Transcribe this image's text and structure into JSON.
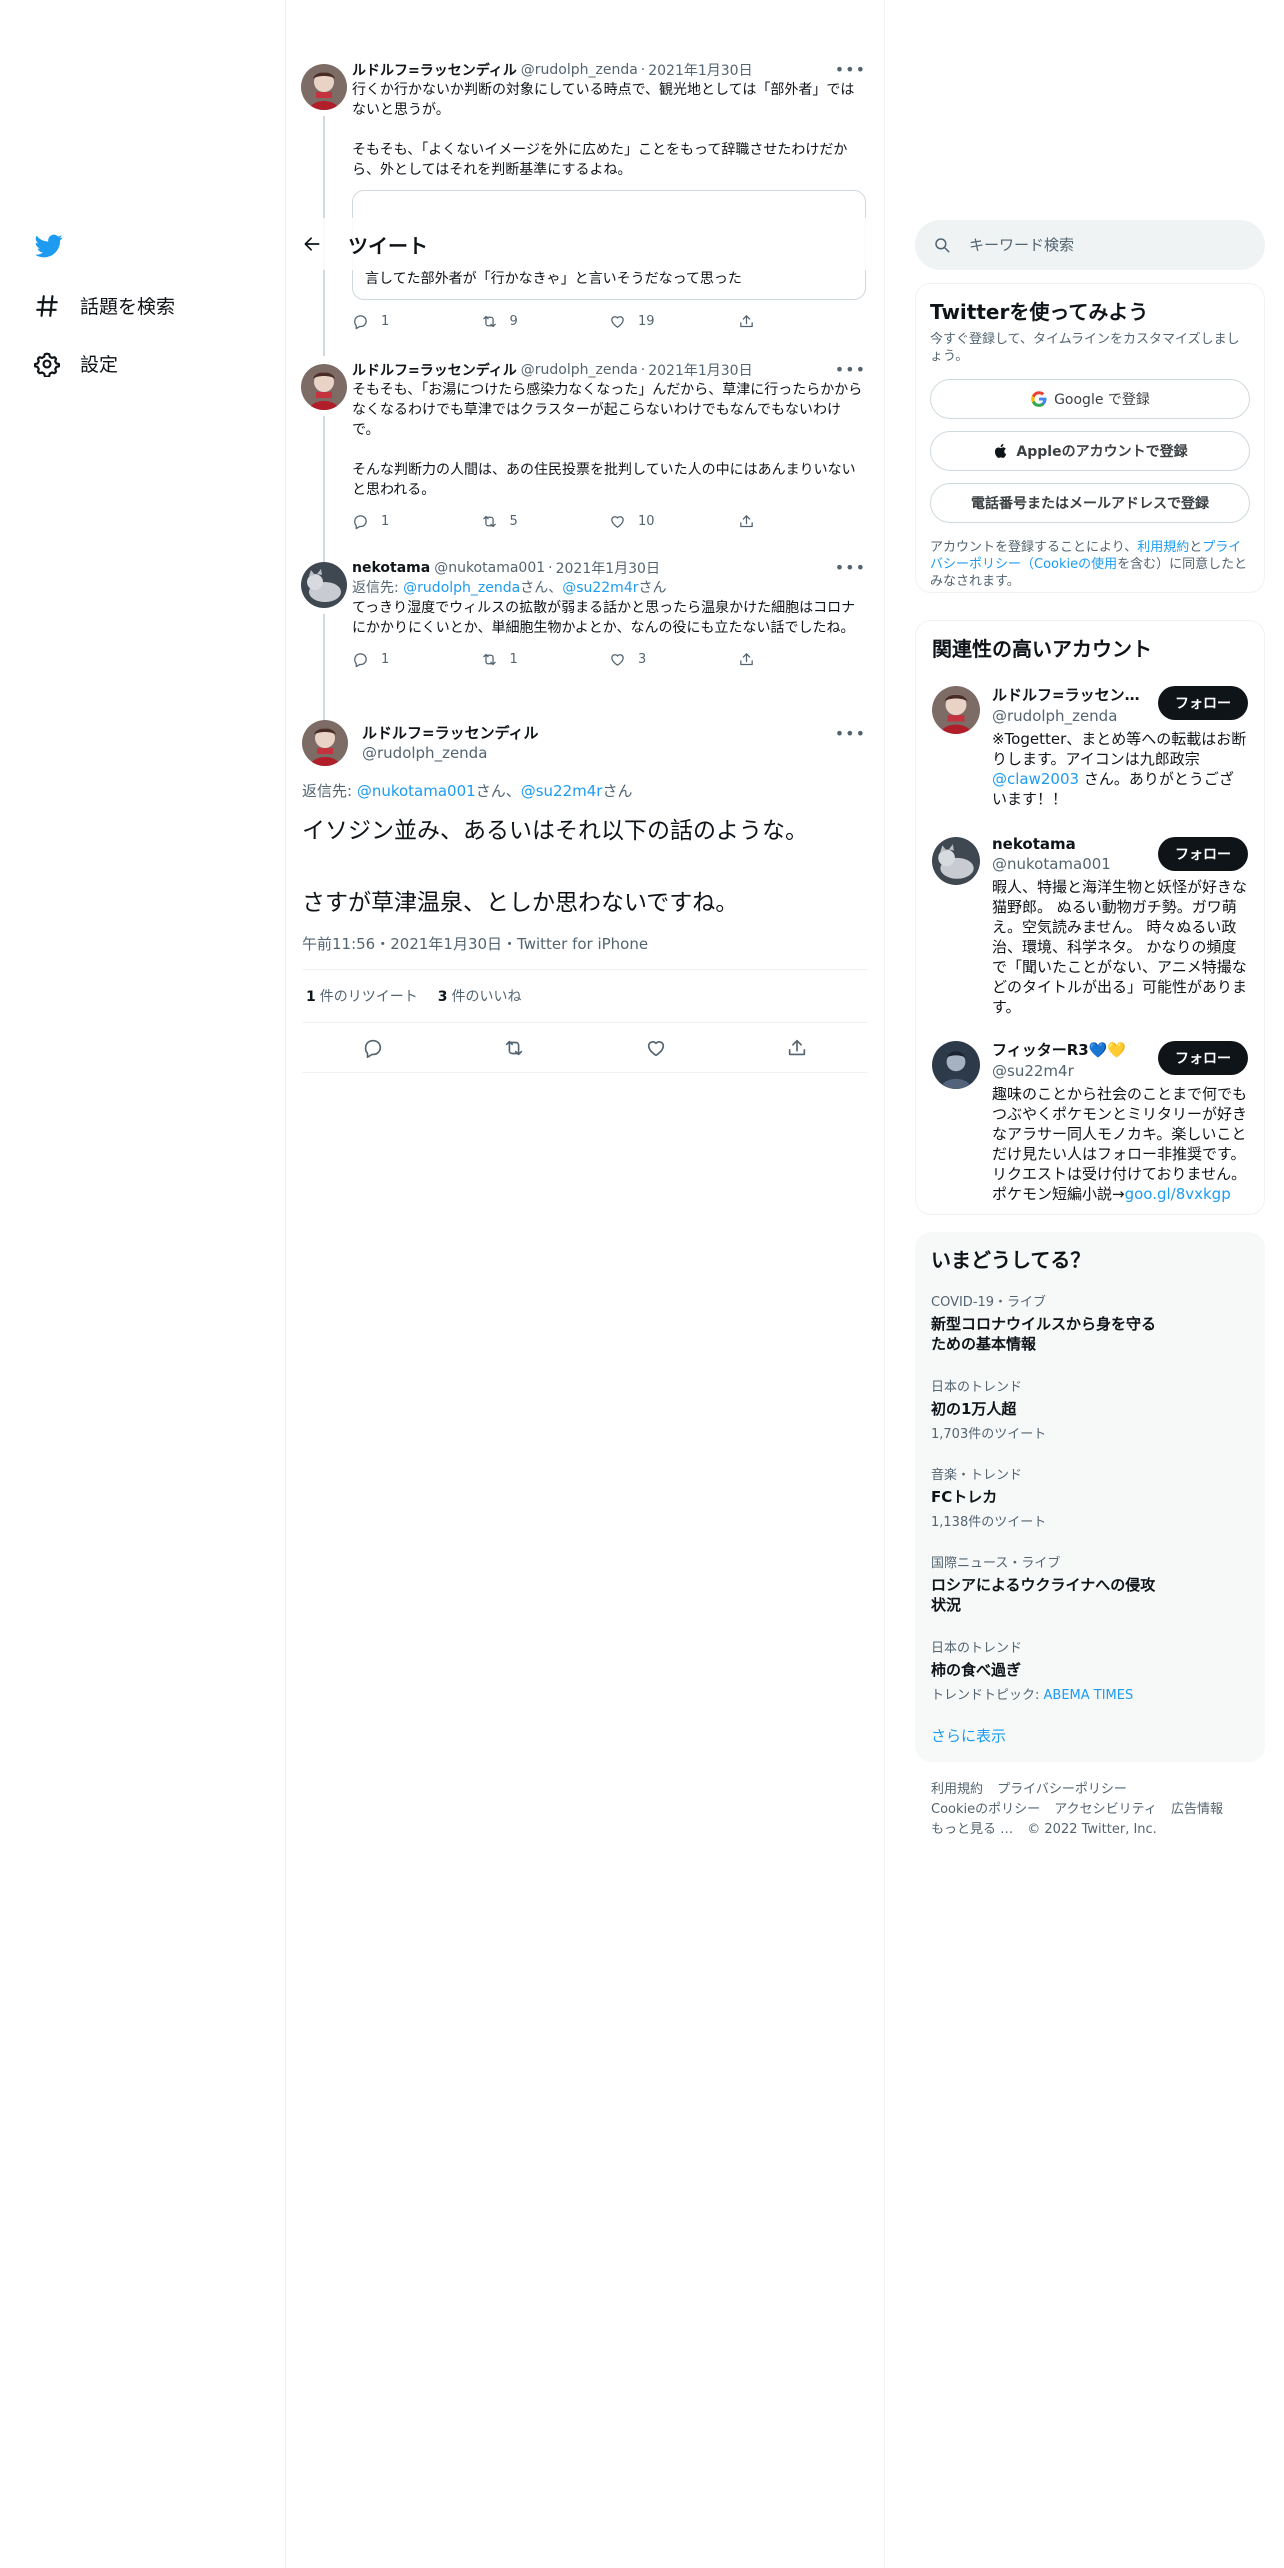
{
  "nav": {
    "explore_label": "話題を検索",
    "settings_label": "設定"
  },
  "header": {
    "title": "ツイート"
  },
  "thread": [
    {
      "name": "ルドルフ=ラッセンディル",
      "handle": "@rudolph_zenda",
      "date": "2021年1月30日",
      "text": "行くか行かないか判断の対象にしている時点で、観光地としては「部外者」ではないと思うが。\n\nそもそも、「よくないイメージを外に広めた」ことをもって辞職させたわけだから、外としてはそれを判断基準にするよね。",
      "quote_text": "言してた部外者が「行かなきゃ」と言いそうだなって思った",
      "replies": "1",
      "retweets": "9",
      "likes": "19"
    },
    {
      "name": "ルドルフ=ラッセンディル",
      "handle": "@rudolph_zenda",
      "date": "2021年1月30日",
      "text": "そもそも、「お湯につけたら感染力なくなった」んだから、草津に行ったらかからなくなるわけでも草津ではクラスターが起こらないわけでもなんでもないわけで。\n\nそんな判断力の人間は、あの住民投票を批判していた人の中にはあんまりいないと思われる。",
      "replies": "1",
      "retweets": "5",
      "likes": "10"
    },
    {
      "name": "nekotama",
      "handle": "@nukotama001",
      "date": "2021年1月30日",
      "reply_prefix": "返信先: ",
      "reply_user1": "@rudolph_zenda",
      "reply_san1": "さん、",
      "reply_user2": "@su22m4r",
      "reply_san2": "さん",
      "text": "てっきり湿度でウィルスの拡散が弱まる話かと思ったら温泉かけた細胞はコロナにかかりにくいとか、単細胞生物かよとか、なんの役にも立たない話でしたね。",
      "replies": "1",
      "retweets": "1",
      "likes": "3"
    }
  ],
  "main_tweet": {
    "name": "ルドルフ=ラッセンディル",
    "handle": "@rudolph_zenda",
    "reply_prefix": "返信先: ",
    "reply_user1": "@nukotama001",
    "reply_san1": "さん、",
    "reply_user2": "@su22m4r",
    "reply_san2": "さん",
    "text": "イソジン並み、あるいはそれ以下の話のような。\n\nさすが草津温泉、としか思わないですね。",
    "meta": "午前11:56・2021年1月30日・Twitter for iPhone",
    "retweets_count": "1",
    "retweets_label": "件のリツイート",
    "likes_count": "3",
    "likes_label": "件のいいね"
  },
  "search": {
    "placeholder": "キーワード検索"
  },
  "signup": {
    "title": "Twitterを使ってみよう",
    "subtitle": "今すぐ登録して、タイムラインをカスタマイズしましょう。",
    "google_label": "Google で登録",
    "apple_label": "Appleのアカウントで登録",
    "phone_label": "電話番号またはメールアドレスで登録",
    "legal_pre": "アカウントを登録することにより、",
    "legal_terms": "利用規約",
    "legal_and": "と",
    "legal_privacy": "プライバシーポリシー（Cookieの使用",
    "legal_post": "を含む）に同意したとみなされます。"
  },
  "who_to_follow": {
    "title": "関連性の高いアカウント",
    "follow_label": "フォロー",
    "accounts": [
      {
        "name": "ルドルフ=ラッセンディル",
        "handle": "@rudolph_zenda",
        "bio_pre": "※Togetter、まとめ等への転載はお断りします。アイコンは九郎政宗",
        "bio_link": "@claw2003",
        "bio_post": " さん。ありがとうございます！！"
      },
      {
        "name": "nekotama",
        "handle": "@nukotama001",
        "bio": "暇人、特撮と海洋生物と妖怪が好きな猫野郎。 ぬるい動物ガチ勢。ガワ萌え。空気読みません。 時々ぬるい政治、環境、科学ネタ。 かなりの頻度で「聞いたことがない、アニメ特撮などのタイトルが出る」可能性があります。"
      },
      {
        "name": "フィッターR3💙💛",
        "handle": "@su22m4r",
        "bio_pre": "趣味のことから社会のことまで何でもつぶやくポケモンとミリタリーが好きなアラサー同人モノカキ。楽しいことだけ見たい人はフォロー非推奨です。リクエストは受け付けておりません。ポケモン短編小説→",
        "bio_link": "goo.gl/8vxkgp"
      }
    ]
  },
  "trends": {
    "title": "いまどうしてる？",
    "items": [
      {
        "category": "COVID-19・ライブ",
        "title": "新型コロナウイルスから身を守るための基本情報",
        "count": ""
      },
      {
        "category": "日本のトレンド",
        "title": "初の1万人超",
        "count": "1,703件のツイート"
      },
      {
        "category": "音楽・トレンド",
        "title": "FCトレカ",
        "count": "1,138件のツイート"
      },
      {
        "category": "国際ニュース・ライブ",
        "title": "ロシアによるウクライナへの侵攻状況",
        "count": ""
      },
      {
        "category": "日本のトレンド",
        "title": "柿の食べ過ぎ",
        "count_pre": "トレンドトピック: ",
        "count_link": "ABEMA TIMES"
      }
    ],
    "show_more": "さらに表示"
  },
  "footer": {
    "links": [
      "利用規約",
      "プライバシーポリシー",
      "Cookieのポリシー",
      "アクセシビリティ",
      "広告情報",
      "もっと見る …"
    ],
    "copyright": "© 2022 Twitter, Inc."
  },
  "colors": {
    "accent": "#1d9bf0",
    "text": "#0f1419",
    "secondary": "#536471",
    "border": "#eff3f4"
  }
}
